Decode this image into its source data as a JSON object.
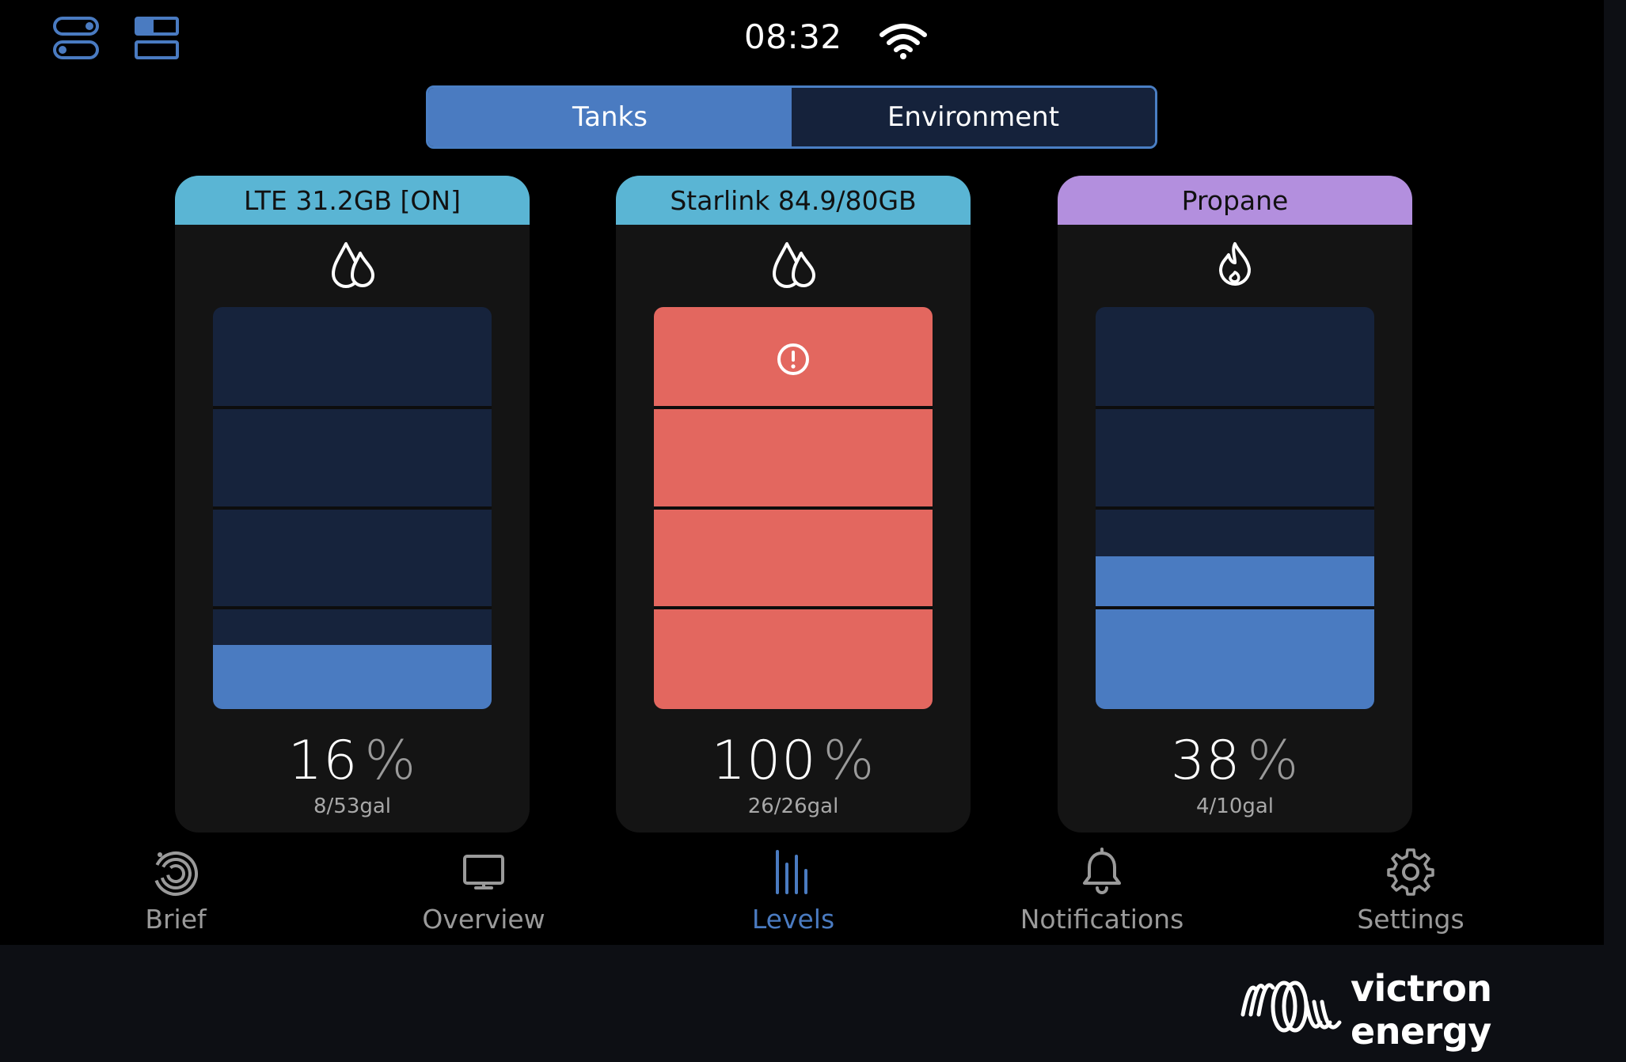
{
  "status_bar": {
    "time": "08:32",
    "left_icons": [
      "toggles-icon",
      "layout-icon"
    ],
    "wifi_icon": "wifi-icon"
  },
  "segmented": {
    "tabs": [
      {
        "label": "Tanks",
        "active": true
      },
      {
        "label": "Environment",
        "active": false
      }
    ]
  },
  "tanks": [
    {
      "name": "LTE 31.2GB [ON]",
      "icon": "water-drops-icon",
      "header_color": "#5ab5d4",
      "level_fraction": 0.16,
      "percent": "16",
      "percent_unit": "%",
      "volume": "8/53gal",
      "alert": false
    },
    {
      "name": "Starlink 84.9/80GB",
      "icon": "water-drops-icon",
      "header_color": "#5ab5d4",
      "level_fraction": 1.0,
      "percent": "100",
      "percent_unit": "%",
      "volume": "26/26gal",
      "alert": true
    },
    {
      "name": "Propane",
      "icon": "flame-icon",
      "header_color": "#b38fde",
      "level_fraction": 0.38,
      "percent": "38",
      "percent_unit": "%",
      "volume": "4/10gal",
      "alert": false
    }
  ],
  "colors": {
    "fill_normal": "#4a7bc1",
    "fill_alert": "#e3675f",
    "gauge_empty": "#16233c",
    "accent": "#4a7bc1"
  },
  "nav": {
    "items": [
      {
        "label": "Brief",
        "icon": "brief-icon",
        "active": false
      },
      {
        "label": "Overview",
        "icon": "overview-icon",
        "active": false
      },
      {
        "label": "Levels",
        "icon": "levels-icon",
        "active": true
      },
      {
        "label": "Notifications",
        "icon": "bell-icon",
        "active": false
      },
      {
        "label": "Settings",
        "icon": "gear-icon",
        "active": false
      }
    ]
  },
  "brand": {
    "logo_text": "victron energy"
  }
}
